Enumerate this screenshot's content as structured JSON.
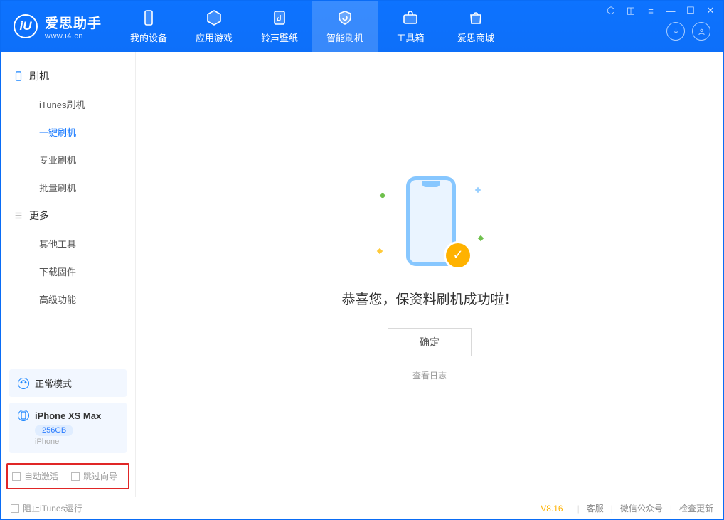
{
  "brand": {
    "name": "爱思助手",
    "url": "www.i4.cn",
    "logo_letter": "iU"
  },
  "topnav": [
    {
      "label": "我的设备"
    },
    {
      "label": "应用游戏"
    },
    {
      "label": "铃声壁纸"
    },
    {
      "label": "智能刷机",
      "active": true
    },
    {
      "label": "工具箱"
    },
    {
      "label": "爱思商城"
    }
  ],
  "sidebar": {
    "section1": {
      "title": "刷机",
      "items": [
        "iTunes刷机",
        "一键刷机",
        "专业刷机",
        "批量刷机"
      ],
      "active_index": 1
    },
    "section2": {
      "title": "更多",
      "items": [
        "其他工具",
        "下载固件",
        "高级功能"
      ]
    },
    "mode_card": "正常模式",
    "device": {
      "name": "iPhone XS Max",
      "storage": "256GB",
      "type": "iPhone"
    },
    "checks": {
      "auto_activate": "自动激活",
      "skip_guide": "跳过向导"
    }
  },
  "main": {
    "message": "恭喜您，保资料刷机成功啦！",
    "ok": "确定",
    "log": "查看日志"
  },
  "status": {
    "block_itunes": "阻止iTunes运行",
    "version": "V8.16",
    "links": [
      "客服",
      "微信公众号",
      "检查更新"
    ]
  }
}
